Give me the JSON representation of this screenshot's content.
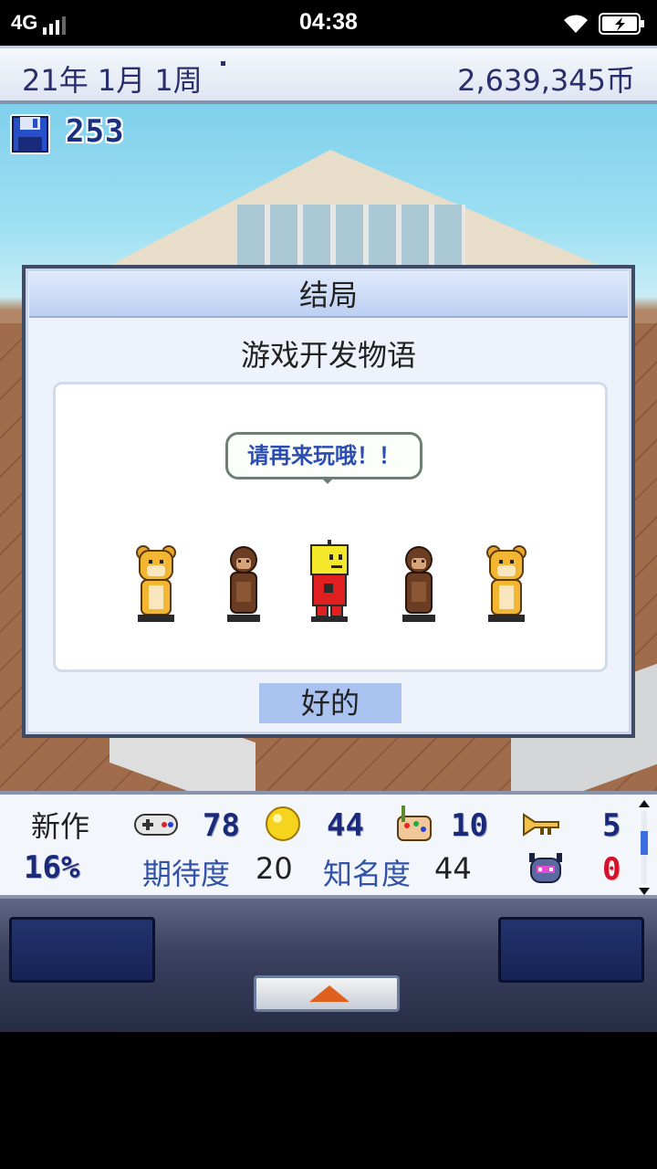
{
  "status_bar": {
    "network": "4G",
    "time": "04:38"
  },
  "top_bar": {
    "date": "21年 1月 1周",
    "money": "2,639,345币"
  },
  "save": {
    "count": "253"
  },
  "dialog": {
    "title": "结局",
    "game_title": "游戏开发物语",
    "speech": "请再来玩哦！！",
    "ok_button": "好的",
    "characters": [
      "bear-mascot-icon",
      "monkey-icon",
      "yellow-robot-icon",
      "monkey-icon",
      "bear-mascot-icon"
    ]
  },
  "stats": {
    "new_title_label": "新作",
    "progress": "16%",
    "fun_value": "78",
    "creativity_value": "44",
    "graphics_value": "10",
    "sound_value": "5",
    "bugs_value": "0",
    "expectation_label": "期待度",
    "expectation_value": "20",
    "fame_label": "知名度",
    "fame_value": "44"
  }
}
